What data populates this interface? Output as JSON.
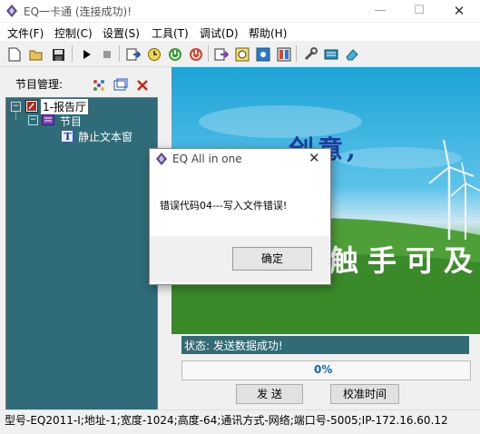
{
  "window": {
    "title": "EQ一卡通 (连接成功)!"
  },
  "menu": {
    "items": [
      "文件(F)",
      "控制(C)",
      "设置(S)",
      "工具(T)",
      "调试(D)",
      "帮助(H)"
    ]
  },
  "left_panel": {
    "label": "节目管理:",
    "tree": [
      {
        "label": "1-报告厅"
      },
      {
        "label": "节目"
      },
      {
        "label": "静止文本窗"
      }
    ]
  },
  "preview": {
    "text_line1": "创意,",
    "text_line2": "触手可及"
  },
  "status": {
    "text": "状态: 发送数据成功!",
    "progress_label": "0%",
    "progress": 0
  },
  "buttons": {
    "send": "发  送",
    "calibrate": "校准时间"
  },
  "bottom_status": {
    "text": "型号-EQ2011-I;地址-1;宽度-1024;高度-64;通讯方式-网络;端口号-5005;IP-172.16.60.12"
  },
  "dialog": {
    "title": "EQ All in one",
    "message": "错误代码04---写入文件错误!",
    "ok_label": "确定"
  },
  "colors": {
    "tree_bg": "#2f6b78",
    "status_bg": "#336b74",
    "progress_text": "#1565b0"
  }
}
